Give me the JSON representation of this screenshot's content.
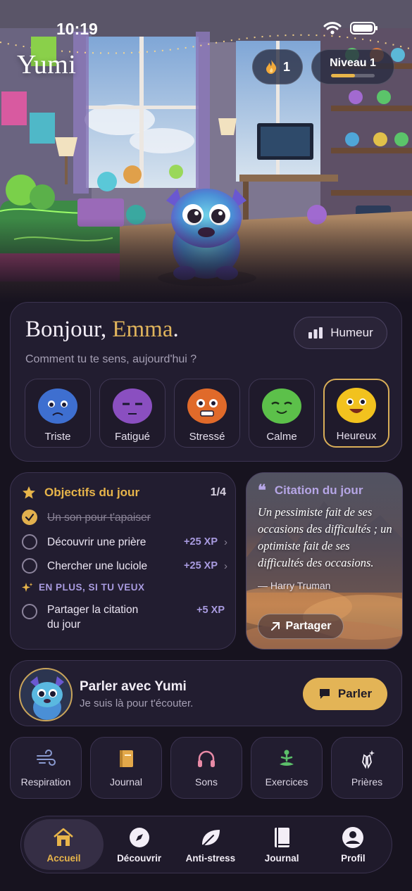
{
  "status_bar": {
    "time": "10:19"
  },
  "app": {
    "logo": "Yumi"
  },
  "header": {
    "streak": {
      "icon": "flame-icon",
      "value": "1"
    },
    "level": {
      "label": "Niveau 1",
      "progress": 0.55
    }
  },
  "greeting": {
    "hello": "Bonjour,",
    "name": "Emma",
    "period": ".",
    "question": "Comment tu te sens, aujourd'hui ?",
    "mood_button": "Humeur",
    "moods": [
      {
        "label": "Triste",
        "color": "#3e6fd0",
        "selected": false
      },
      {
        "label": "Fatigué",
        "color": "#8a4fc0",
        "selected": false
      },
      {
        "label": "Stressé",
        "color": "#e06a2a",
        "selected": false
      },
      {
        "label": "Calme",
        "color": "#5cc04a",
        "selected": false
      },
      {
        "label": "Heureux",
        "color": "#f2c21e",
        "selected": true
      }
    ]
  },
  "objectives": {
    "title": "Objectifs du jour",
    "count": "1/4",
    "items": [
      {
        "label": "Un son pour t'apaiser",
        "done": true,
        "xp": ""
      },
      {
        "label": "Découvrir une prière",
        "done": false,
        "xp": "+25 XP"
      },
      {
        "label": "Chercher une luciole",
        "done": false,
        "xp": "+25 XP"
      }
    ],
    "extra_label": "EN PLUS, SI TU VEUX",
    "extra": {
      "label_line1": "Partager la citation",
      "label_line2": "du jour",
      "xp": "+5 XP"
    }
  },
  "quote": {
    "title": "Citation du jour",
    "text": "Un pessimiste fait de ses occasions des difficultés ; un optimiste fait de ses difficultés des occasions.",
    "author": "— Harry Truman",
    "share": "Partager"
  },
  "talk": {
    "title": "Parler avec Yumi",
    "subtitle": "Je suis là pour t'écouter.",
    "button": "Parler"
  },
  "tools": [
    {
      "label": "Respiration",
      "icon": "wind-icon"
    },
    {
      "label": "Journal",
      "icon": "book-icon"
    },
    {
      "label": "Sons",
      "icon": "headphones-icon"
    },
    {
      "label": "Exercices",
      "icon": "meditation-icon"
    },
    {
      "label": "Prières",
      "icon": "praying-hands-icon"
    }
  ],
  "tabs": [
    {
      "label": "Accueil",
      "icon": "home-icon",
      "active": true
    },
    {
      "label": "Découvrir",
      "icon": "compass-icon",
      "active": false
    },
    {
      "label": "Anti-stress",
      "icon": "leaf-icon",
      "active": false
    },
    {
      "label": "Journal",
      "icon": "book-icon",
      "active": false
    },
    {
      "label": "Profil",
      "icon": "profile-icon",
      "active": false
    }
  ],
  "colors": {
    "accent": "#e3b456",
    "xp": "#a99be0",
    "background": "#17131f",
    "card": "#221d30"
  }
}
